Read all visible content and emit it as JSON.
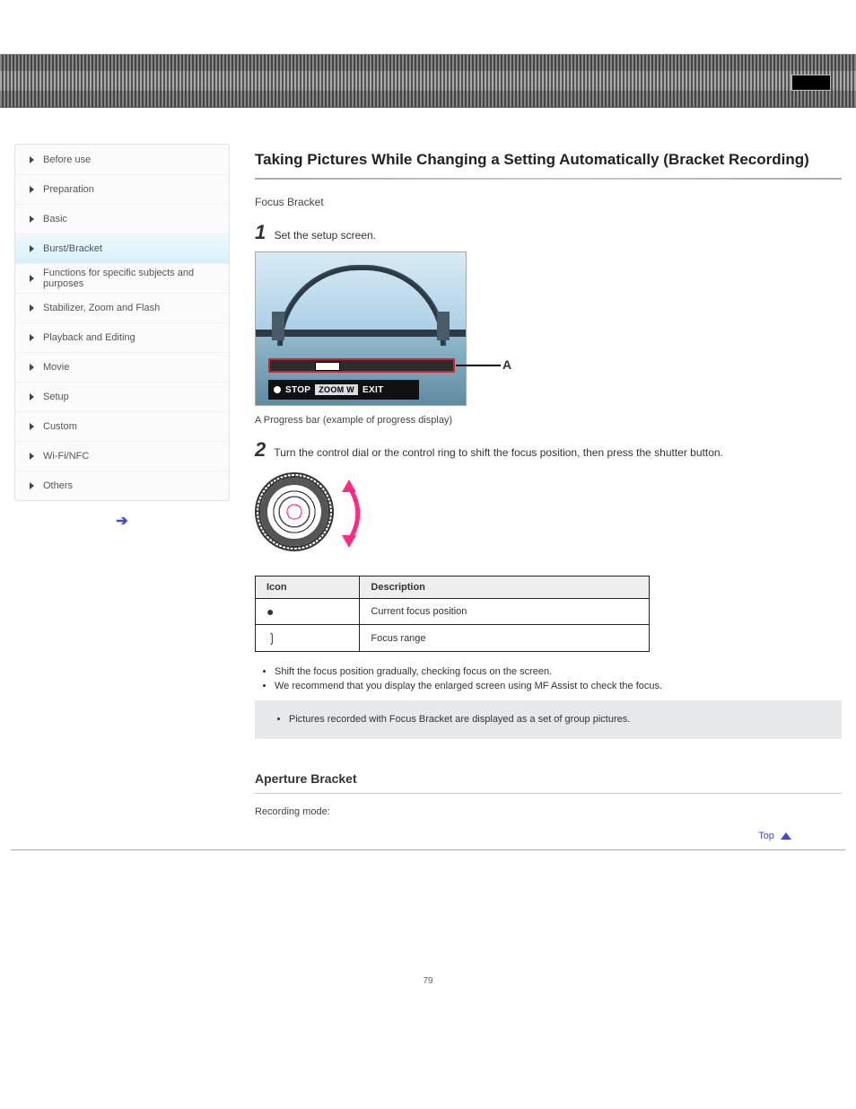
{
  "page_number": "79",
  "sidebar": {
    "items": [
      {
        "label": "Before use",
        "active": false
      },
      {
        "label": "Preparation",
        "active": false
      },
      {
        "label": "Basic",
        "active": false
      },
      {
        "label": "Burst/Bracket",
        "active": true
      },
      {
        "label": "Functions for specific subjects and purposes",
        "active": false
      },
      {
        "label": "Stabilizer, Zoom and Flash",
        "active": false
      },
      {
        "label": "Playback and Editing",
        "active": false
      },
      {
        "label": "Movie",
        "active": false
      },
      {
        "label": "Setup",
        "active": false
      },
      {
        "label": "Custom",
        "active": false
      },
      {
        "label": "Wi-Fi/NFC",
        "active": false
      },
      {
        "label": "Others",
        "active": false
      }
    ]
  },
  "main": {
    "section_title": "Taking Pictures While Changing a Setting Automatically (Bracket Recording)",
    "subsection_title": "Focus Bracket",
    "step1": "Set the setup screen.",
    "step1_num": "1",
    "photo_caller_label": "A",
    "osd_stop": "STOP",
    "osd_zoom": "ZOOM W",
    "osd_exit": "EXIT",
    "helper_note": "A  Progress bar (example of progress display)",
    "step2_num": "2",
    "step2": "Turn the control dial or the control ring to shift the focus position, then press the shutter button.",
    "icon_table": {
      "head_icon": "Icon",
      "head_mean": "Description",
      "rows": [
        {
          "icon": "●",
          "mean": "Current focus position"
        },
        {
          "icon": "❳",
          "mean": "Focus range"
        }
      ]
    },
    "bullets": [
      "Shift the focus position gradually, checking focus on the screen.",
      "We recommend that you display the enlarged screen using MF Assist to check the focus."
    ],
    "note": "Pictures recorded with Focus Bracket are displayed as a set of group pictures.",
    "sub_heading": "Aperture Bracket",
    "sub_caption": "Recording mode:",
    "top_link_label": "Top"
  }
}
